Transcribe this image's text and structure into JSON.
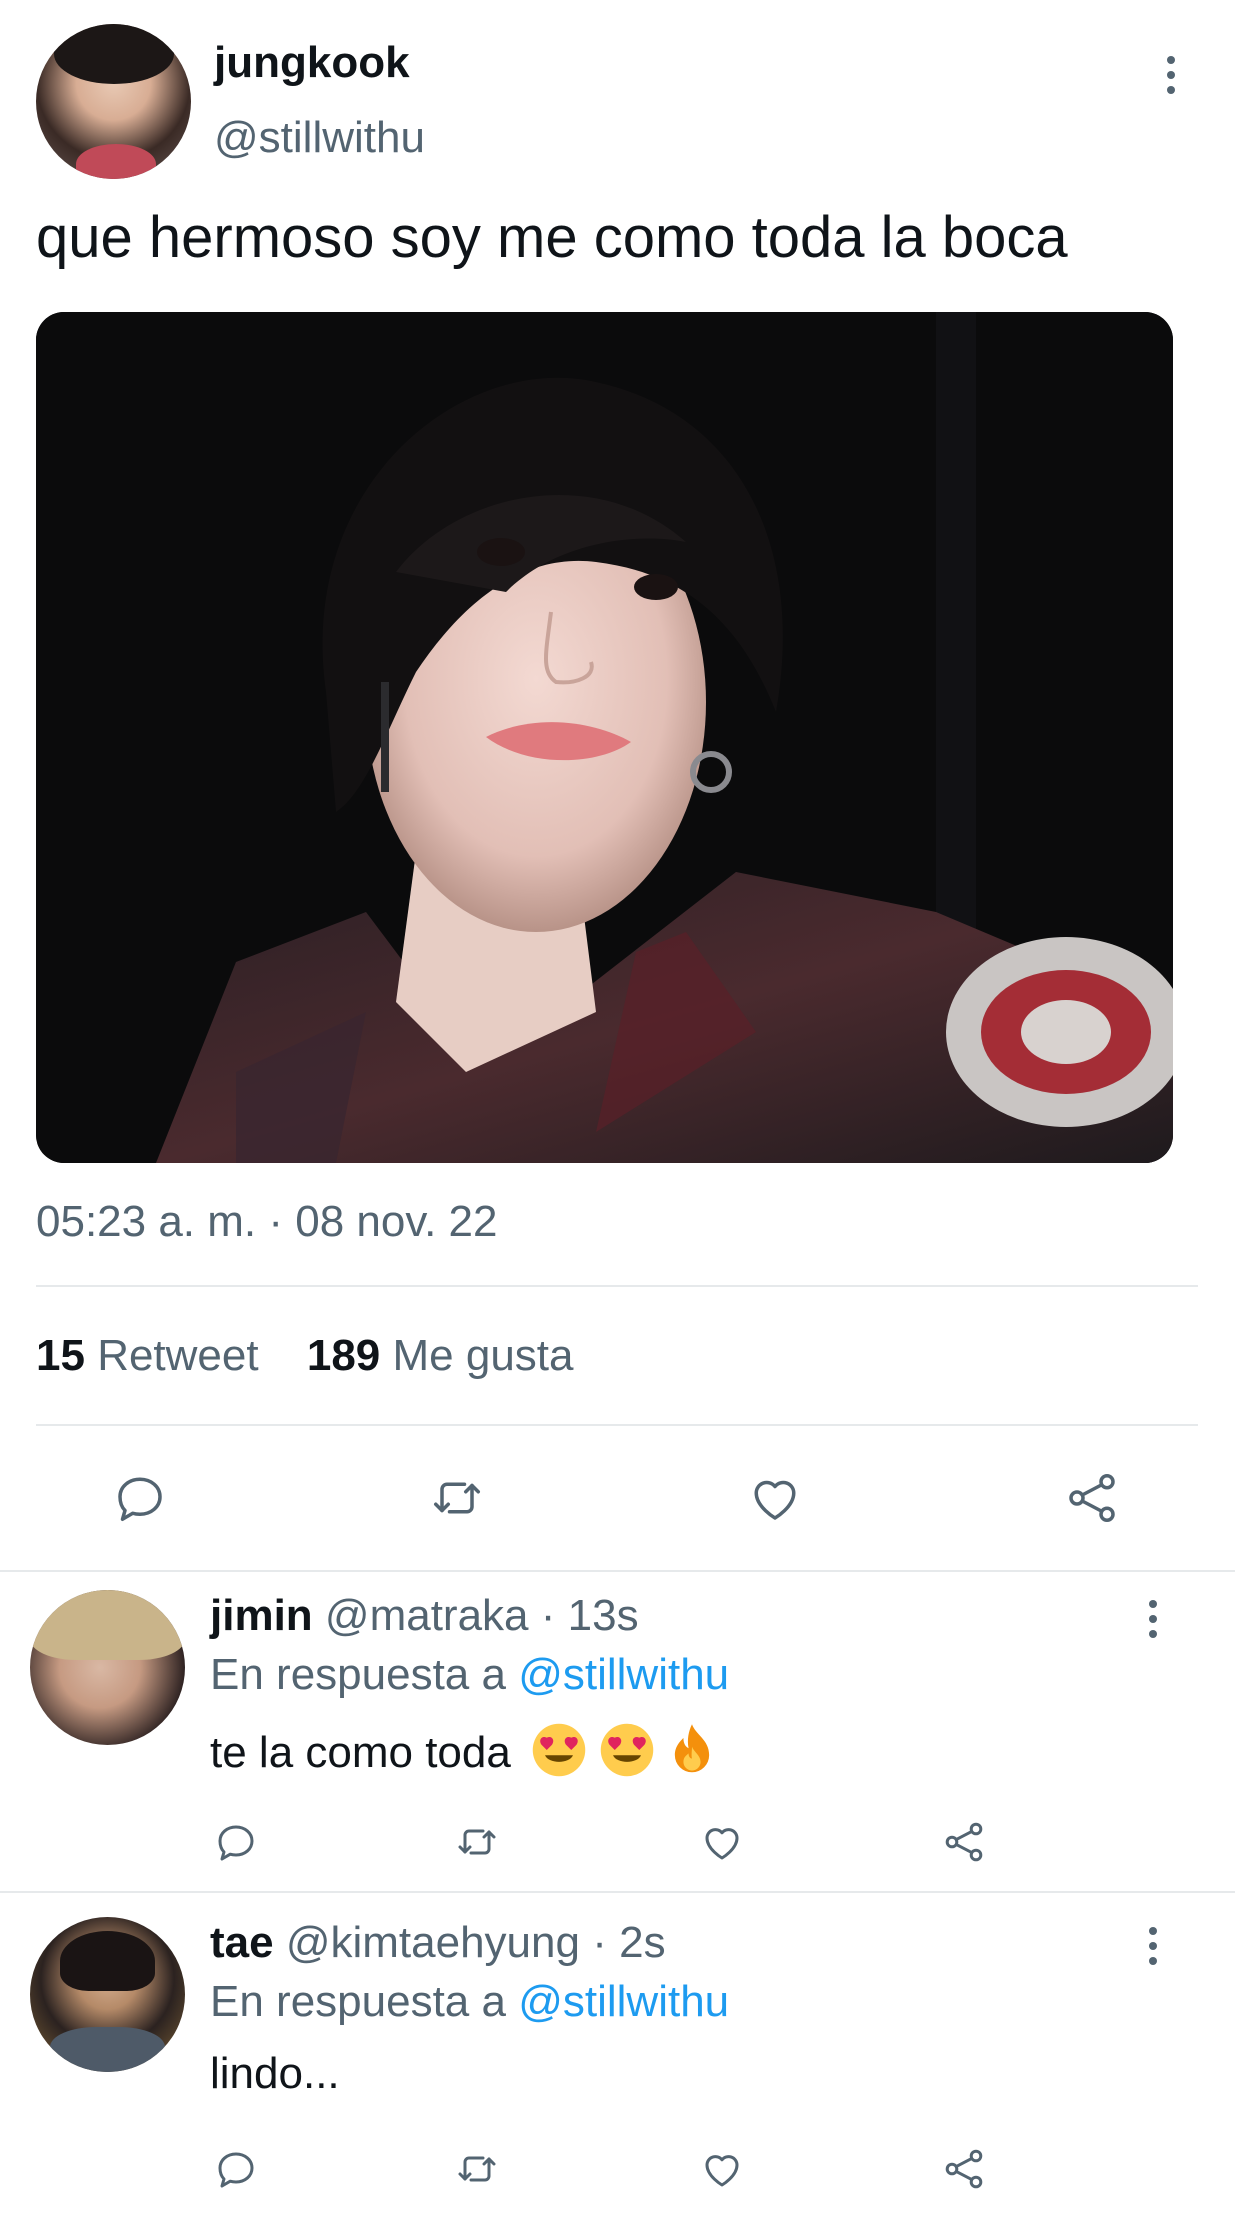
{
  "main_tweet": {
    "author_name": "jungkook",
    "author_handle": "@stillwithu",
    "text": "que hermoso soy me como toda la boca",
    "timestamp": "05:23 a. m. · 08 nov. 22",
    "retweet_count": "15",
    "retweet_label": "Retweet",
    "like_count": "189",
    "like_label": "Me gusta"
  },
  "replies": [
    {
      "name": "jimin",
      "handle": "@matraka",
      "time": "· 13s",
      "reply_prefix": "En respuesta a",
      "reply_to": "@stillwithu",
      "text": "te la como toda"
    },
    {
      "name": "tae",
      "handle": "@kimtaehyung",
      "time": "· 2s",
      "reply_prefix": "En respuesta a",
      "reply_to": "@stillwithu",
      "text": "lindo..."
    }
  ],
  "icons": [
    "more-vertical-icon",
    "reply-icon",
    "retweet-icon",
    "like-icon",
    "share-icon",
    "heart-eyes-emoji",
    "fire-emoji"
  ],
  "colors": {
    "text": "#0f1419",
    "secondary": "#536471",
    "link": "#1d9bf0",
    "divider": "#e6e9eb",
    "icon": "#536471"
  }
}
